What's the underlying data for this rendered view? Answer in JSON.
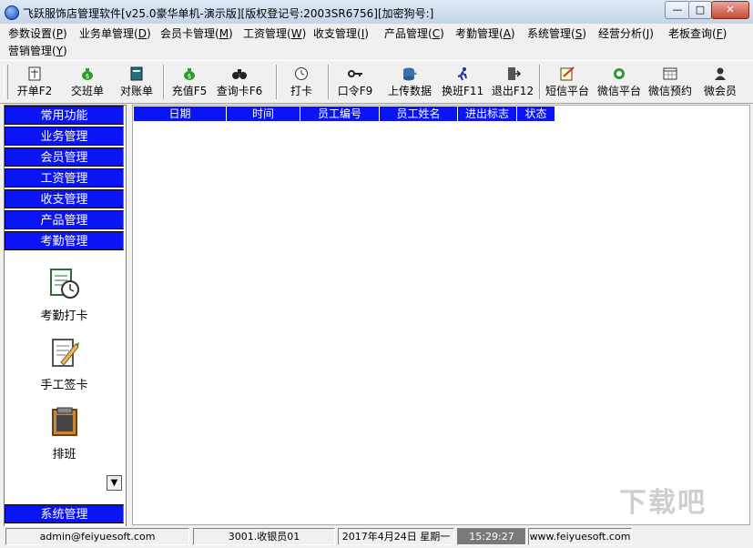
{
  "window": {
    "title": "飞跃服饰店管理软件[v25.0豪华单机-演示版][版权登记号:2003SR6756][加密狗号:]",
    "minimize": "—",
    "maximize": "□",
    "close": "✕"
  },
  "menu": {
    "items": [
      {
        "label": "参数设置(",
        "key": "P",
        "end": ")"
      },
      {
        "label": "业务单管理(",
        "key": "D",
        "end": ")"
      },
      {
        "label": "会员卡管理(",
        "key": "M",
        "end": ")"
      },
      {
        "label": "工资管理(",
        "key": "W",
        "end": ")"
      },
      {
        "label": "收支管理(",
        "key": "I",
        "end": ")"
      },
      {
        "label": "产品管理(",
        "key": "C",
        "end": ")"
      },
      {
        "label": "考勤管理(",
        "key": "A",
        "end": ")"
      },
      {
        "label": "系统管理(",
        "key": "S",
        "end": ")"
      },
      {
        "label": "经营分析(",
        "key": "J",
        "end": ")"
      },
      {
        "label": "老板查询(",
        "key": "F",
        "end": ")"
      },
      {
        "label": "营销管理(",
        "key": "Y",
        "end": ")"
      }
    ]
  },
  "toolbar": {
    "buttons": [
      {
        "label": "开单F2",
        "icon": "invoice-icon"
      },
      {
        "label": "交班单",
        "icon": "money-bag-icon"
      },
      {
        "label": "对账单",
        "icon": "ledger-icon"
      },
      {
        "label": "充值F5",
        "icon": "money-bag-icon"
      },
      {
        "label": "查询卡F6",
        "icon": "binoculars-icon"
      },
      {
        "label": "打卡",
        "icon": "clock-icon"
      },
      {
        "label": "口令F9",
        "icon": "key-icon"
      },
      {
        "label": "上传数据",
        "icon": "database-upload-icon"
      },
      {
        "label": "换班F11",
        "icon": "runner-icon"
      },
      {
        "label": "退出F12",
        "icon": "exit-door-icon"
      },
      {
        "label": "短信平台",
        "icon": "sms-icon"
      },
      {
        "label": "微信平台",
        "icon": "wechat-icon"
      },
      {
        "label": "微信预约",
        "icon": "calendar-icon"
      },
      {
        "label": "微会员",
        "icon": "member-icon"
      }
    ]
  },
  "sidebar": {
    "categories": [
      "常用功能",
      "业务管理",
      "会员管理",
      "工资管理",
      "收支管理",
      "产品管理",
      "考勤管理"
    ],
    "tools": [
      {
        "label": "考勤打卡",
        "icon": "attendance-clock-icon"
      },
      {
        "label": "手工签卡",
        "icon": "manual-sign-icon"
      },
      {
        "label": "排班",
        "icon": "shift-schedule-icon"
      }
    ],
    "bottom_category": "系统管理",
    "scroll_glyph": "▼"
  },
  "grid": {
    "columns": [
      "日期",
      "时间",
      "员工编号",
      "员工姓名",
      "进出标志",
      "状态"
    ]
  },
  "status": {
    "email": "admin@feiyuesoft.com",
    "cashier": "3001.收银员01",
    "date": "2017年4月24日  星期一",
    "time": "15:29:27",
    "website": "www.feiyuesoft.com"
  },
  "watermark": "下载吧",
  "colors": {
    "accent_blue": "#0a14f5",
    "time_bg": "#7a7a7a"
  }
}
